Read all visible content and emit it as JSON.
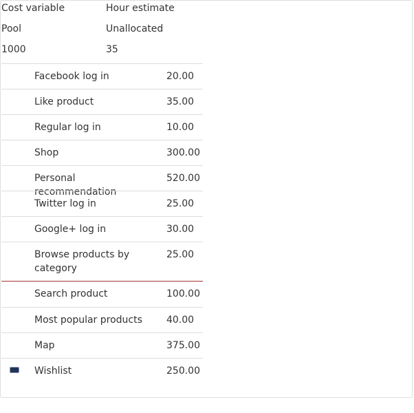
{
  "header": {
    "col1_label": "Cost variable",
    "col2_label": "Hour estimate",
    "pool_label": "Pool",
    "unallocated_label": "Unallocated",
    "pool_value": "1000",
    "unallocated_value": "35"
  },
  "items": [
    {
      "name": "Facebook log in",
      "hours": "20.00"
    },
    {
      "name": "Like product",
      "hours": "35.00"
    },
    {
      "name": "Regular log in",
      "hours": "10.00"
    },
    {
      "name": "Shop",
      "hours": "300.00"
    },
    {
      "name": "Personal recommendation",
      "hours": "520.00"
    },
    {
      "name": "Twitter log in",
      "hours": "25.00"
    },
    {
      "name": "Google+ log in",
      "hours": "30.00"
    },
    {
      "name": "Browse products by category",
      "hours": "25.00"
    },
    {
      "name": "Search product",
      "hours": "100.00"
    },
    {
      "name": "Most popular products",
      "hours": "40.00"
    },
    {
      "name": "Map",
      "hours": "375.00"
    },
    {
      "name": "Wishlist",
      "hours": "250.00"
    }
  ],
  "colors": {
    "accent_border": "#a33333",
    "drag_handle": "#1f3458"
  }
}
